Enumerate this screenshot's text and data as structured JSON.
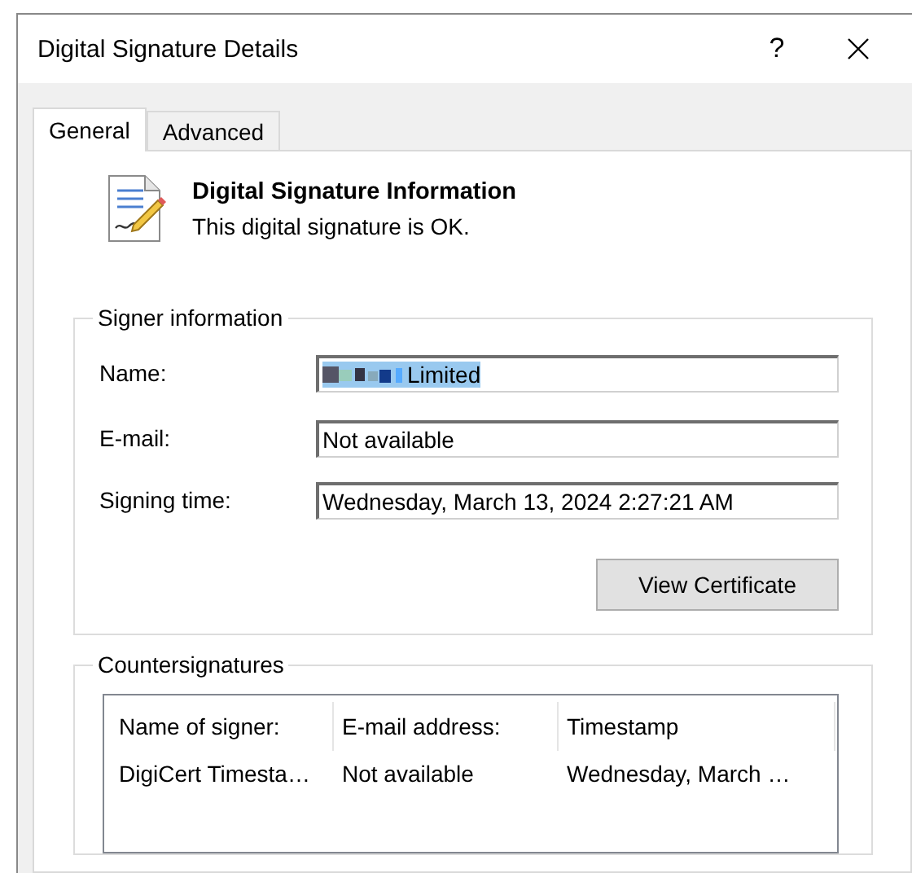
{
  "window": {
    "title": "Digital Signature Details",
    "help_button": "?"
  },
  "tabs": [
    {
      "label": "General",
      "selected": true
    },
    {
      "label": "Advanced",
      "selected": false
    }
  ],
  "header": {
    "title": "Digital Signature Information",
    "status": "This digital signature is OK."
  },
  "signer_information": {
    "title": "Signer information",
    "fields": [
      {
        "label": "Name:",
        "value": "Limited",
        "redacted": true,
        "selected": true
      },
      {
        "label": "E-mail:",
        "value": "Not available",
        "redacted": false,
        "selected": false
      },
      {
        "label": "Signing time:",
        "value": "Wednesday, March 13, 2024 2:27:21 AM",
        "redacted": false,
        "selected": false
      }
    ],
    "button": "View Certificate"
  },
  "countersignatures": {
    "title": "Countersignatures",
    "columns": [
      "Name of signer:",
      "E-mail address:",
      "Timestamp"
    ],
    "rows": [
      [
        "DigiCert Timesta…",
        "Not available",
        "Wednesday, March …"
      ]
    ]
  }
}
